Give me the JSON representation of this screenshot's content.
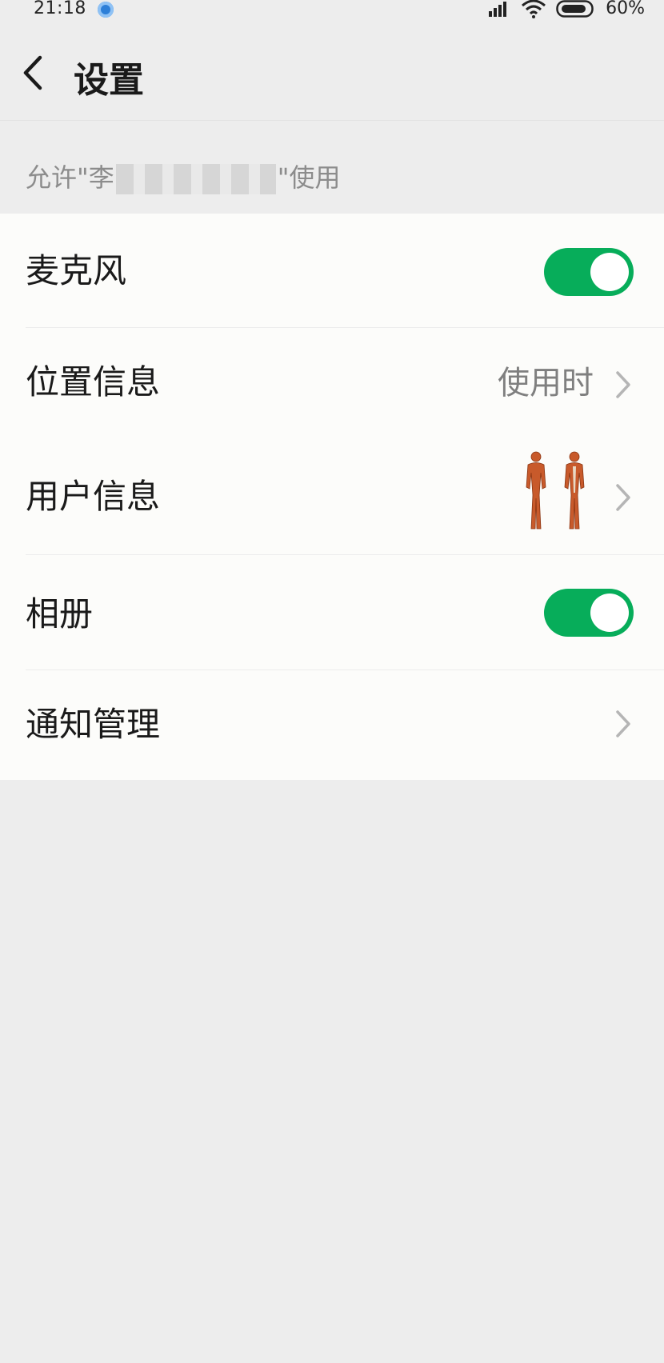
{
  "status_bar": {
    "time": "21:18",
    "battery": "60%",
    "icons": [
      "app-notification-icon",
      "signal-icon",
      "wifi-icon",
      "battery-icon"
    ]
  },
  "nav": {
    "title": "设置",
    "back_icon": "chevron-left-icon"
  },
  "section": {
    "prefix": "允许\"李",
    "suffix": "\"使用"
  },
  "items": [
    {
      "label": "麦克风",
      "control": "toggle",
      "on": true
    },
    {
      "label": "位置信息",
      "value": "使用时",
      "control": "chevron"
    },
    {
      "label": "用户信息",
      "control": "chevron",
      "thumbnail": "anatomy-figures-image"
    },
    {
      "label": "相册",
      "control": "toggle",
      "on": true
    },
    {
      "label": "通知管理",
      "control": "chevron"
    }
  ],
  "colors": {
    "accent": "#07ad5a",
    "background": "#ededed",
    "list_bg": "#fcfcfa",
    "secondary_text": "#7f7f7f"
  }
}
